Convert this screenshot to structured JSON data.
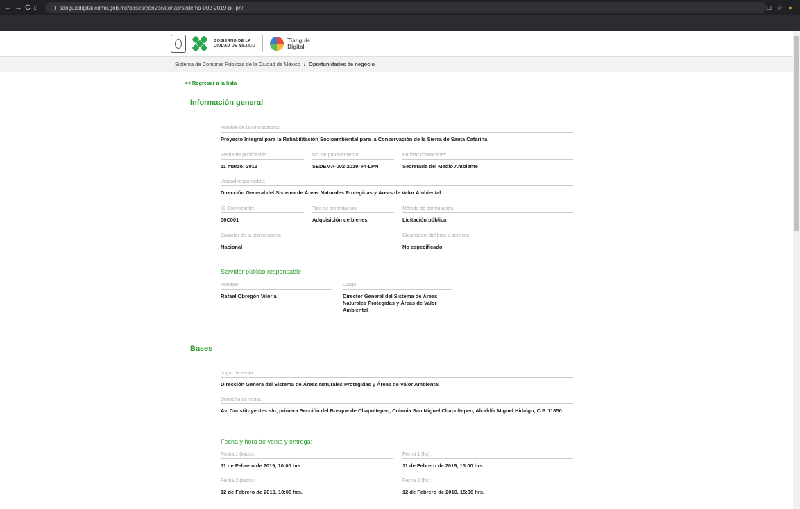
{
  "browser": {
    "url": "tianguisdigital.cdmx.gob.mx/bases/convocatorias/sedema-002-2019-pi-lpn/",
    "nav_back": "←",
    "nav_forward": "→",
    "nav_reload": "C",
    "nav_home": "⌂",
    "right_icons": [
      "⊡",
      "☆",
      "●",
      "⋮"
    ]
  },
  "header": {
    "gob_line1": "GOBIERNO DE LA",
    "gob_line2": "CIUDAD DE MÉXICO",
    "tianguis_line1": "Tianguis",
    "tianguis_line2": "Digital"
  },
  "breadcrumb": {
    "root": "Sistema de Compras Públicas de la Ciudad de México",
    "separator": "/",
    "current": "Oportunidades de negocio"
  },
  "back_link": "<< Regresar a la lista",
  "info_general": {
    "title": "Información general",
    "nombre_label": "Nombre de la convocatoria:",
    "nombre_value": "Proyecto Integral para la Rehabilitación Socioambiental para la Conservación de la Sierra de Santa Catarina",
    "fecha_label": "Fecha de publicación:",
    "fecha_value": "11 marzo, 2019",
    "procedimiento_label": "No. de procedimiento:",
    "procedimiento_value": "SEDEMA-002-2019- PI-LPN",
    "entidad_label": "Entidad convocante:",
    "entidad_value": "Secretaría del Medio Ambiente",
    "unidad_label": "Unidad responsable:",
    "unidad_value": "Dirección General del Sistema de Áreas Naturales Protegidas y Áreas de Valor Ambiental",
    "id_label": "ID Convocante:",
    "id_value": "06C001",
    "tipo_label": "Tipo de contratación:",
    "tipo_value": "Adquisición de bienes",
    "metodo_label": "Método de contratación:",
    "metodo_value": "Licitación pública",
    "caracter_label": "Carácter de la convocatoria:",
    "caracter_value": "Nacional",
    "clasificador_label": "Clasificador del bien o servicio:",
    "clasificador_value": "No especificado",
    "servidor_title": "Servidor público responsable",
    "nombre_servidor_label": "Nombre:",
    "nombre_servidor_value": "Rafael Obregón Viloria",
    "cargo_label": "Cargo:",
    "cargo_value": "Director General del Sistema de Áreas Naturales Protegidas y Áreas de Valor Ambiental"
  },
  "bases": {
    "title": "Bases",
    "lugar_label": "Lugar de venta:",
    "lugar_value": "Dirección Genera del Sistema de Áreas Naturales Protegidas y Áreas de Valor Ambiental",
    "domicilio_label": "Domicilio de venta:",
    "domicilio_value": "Av. Constituyentes s/n, primera Sección del Bosque de Chapultepec, Colonia San Miguel Chapultepec, Alcaldía Miguel Hidalgo, C.P. 11850",
    "fechas_title": "Fecha y hora de venta y entrega:",
    "fecha1_inicio_label": "Fecha 1 (inicio):",
    "fecha1_inicio_value": "11 de Febrero de 2019, 10:00 hrs.",
    "fecha1_fin_label": "Fecha 1 (fin):",
    "fecha1_fin_value": "11 de Febrero de 2019, 15:00 hrs.",
    "fecha2_inicio_label": "Fecha 2 (inicio):",
    "fecha2_inicio_value": "12 de Febrero de 2019, 10:00 hrs.",
    "fecha2_fin_label": "Fecha 2 (fin):",
    "fecha2_fin_value": "12 de Febrero de 2019, 15:00 hrs."
  }
}
